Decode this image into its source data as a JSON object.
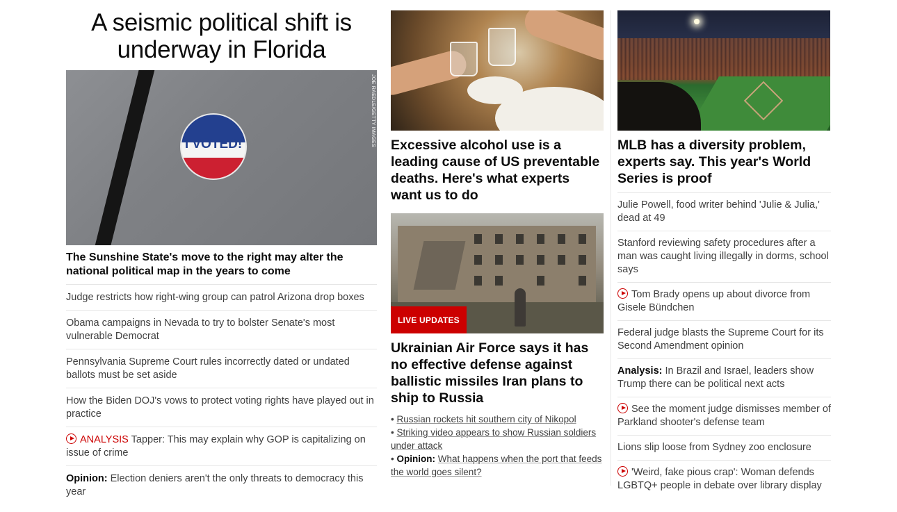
{
  "col1": {
    "hero_title": "A seismic political shift is underway in Florida",
    "hero_image": {
      "description_icon": "voted-sticker-photo",
      "credit": "JOE RAEDLE/GETTY IMAGES",
      "sticker_text": "I VOTED!"
    },
    "hero_sub": "The Sunshine State's move to the right may alter the national political map in the years to come",
    "items": [
      {
        "text": "Judge restricts how right-wing group can patrol Arizona drop boxes"
      },
      {
        "text": "Obama campaigns in Nevada to try to bolster Senate's most vulnerable Democrat"
      },
      {
        "text": "Pennsylvania Supreme Court rules incorrectly dated or undated ballots must be set aside"
      },
      {
        "text": "How the Biden DOJ's vows to protect voting rights have played out in practice"
      },
      {
        "video": true,
        "label": "ANALYSIS",
        "text": "Tapper: This may explain why GOP is capitalizing on issue of crime"
      },
      {
        "prefix": "Opinion:",
        "text": "Election deniers aren't the only threats to democracy this year"
      }
    ]
  },
  "col2": {
    "card1": {
      "headline": "Excessive alcohol use is a leading cause of US preventable deaths. Here's what experts want us to do"
    },
    "card2": {
      "badge": "LIVE UPDATES",
      "headline": "Ukrainian Air Force says it has no effective defense against ballistic missiles Iran plans to ship to Russia",
      "bullets": [
        {
          "text": "Russian rockets hit southern city of Nikopol"
        },
        {
          "text": "Striking video appears to show Russian soldiers under attack"
        },
        {
          "prefix": "Opinion:",
          "text": "What happens when the port that feeds the world goes silent?"
        }
      ]
    }
  },
  "col3": {
    "card": {
      "headline": "MLB has a diversity problem, experts say. This year's World Series is proof"
    },
    "items": [
      {
        "text": "Julie Powell, food writer behind 'Julie & Julia,' dead at 49"
      },
      {
        "text": "Stanford reviewing safety procedures after a man was caught living illegally in dorms, school says"
      },
      {
        "video": true,
        "text": "Tom Brady opens up about divorce from Gisele Bündchen"
      },
      {
        "text": "Federal judge blasts the Supreme Court for its Second Amendment opinion"
      },
      {
        "prefix": "Analysis:",
        "text": "In Brazil and Israel, leaders show Trump there can be political next acts"
      },
      {
        "video": true,
        "text": "See the moment judge dismisses member of Parkland shooter's defense team"
      },
      {
        "text": "Lions slip loose from Sydney zoo enclosure"
      },
      {
        "video": true,
        "text": "'Weird, fake pious crap': Woman defends LGBTQ+ people in debate over library display"
      }
    ]
  },
  "colors": {
    "accent": "#cc0000",
    "text": "#0c0c0c",
    "muted": "#404040",
    "divider": "#e6e6e6"
  }
}
